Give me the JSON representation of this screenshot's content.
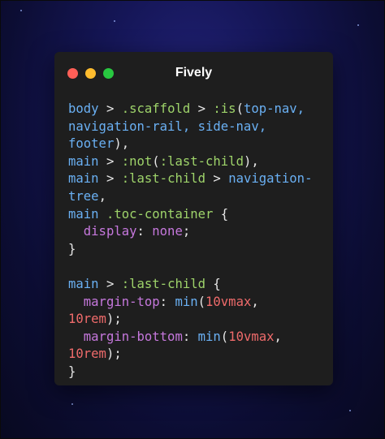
{
  "window": {
    "title": "Fively"
  },
  "colors": {
    "window_bg": "#1e1e1e",
    "close": "#ff5f57",
    "minimize": "#febc2e",
    "maximize": "#28c840",
    "tag": "#6ab0f3",
    "selector": "#9ed36a",
    "property": "#c678dd",
    "number": "#ef6b6b"
  },
  "code": {
    "lines": [
      [
        {
          "t": "body",
          "c": "tag"
        },
        {
          "t": " > ",
          "c": "punc"
        },
        {
          "t": ".scaffold",
          "c": "sel"
        },
        {
          "t": " > ",
          "c": "punc"
        },
        {
          "t": ":is",
          "c": "sel"
        },
        {
          "t": "(",
          "c": "punc"
        },
        {
          "t": "top-nav,",
          "c": "tag"
        }
      ],
      [
        {
          "t": "navigation-rail, side-nav,",
          "c": "tag"
        }
      ],
      [
        {
          "t": "footer",
          "c": "tag"
        },
        {
          "t": "),",
          "c": "punc"
        }
      ],
      [
        {
          "t": "main",
          "c": "tag"
        },
        {
          "t": " > ",
          "c": "punc"
        },
        {
          "t": ":not",
          "c": "sel"
        },
        {
          "t": "(",
          "c": "punc"
        },
        {
          "t": ":last-child",
          "c": "sel"
        },
        {
          "t": "),",
          "c": "punc"
        }
      ],
      [
        {
          "t": "main",
          "c": "tag"
        },
        {
          "t": " > ",
          "c": "punc"
        },
        {
          "t": ":last-child",
          "c": "sel"
        },
        {
          "t": " > ",
          "c": "punc"
        },
        {
          "t": "navigation-",
          "c": "tag"
        }
      ],
      [
        {
          "t": "tree",
          "c": "tag"
        },
        {
          "t": ",",
          "c": "punc"
        }
      ],
      [
        {
          "t": "main",
          "c": "tag"
        },
        {
          "t": " ",
          "c": "punc"
        },
        {
          "t": ".toc-container",
          "c": "sel"
        },
        {
          "t": " {",
          "c": "punc"
        }
      ],
      [
        {
          "t": "  ",
          "c": "punc"
        },
        {
          "t": "display",
          "c": "prop"
        },
        {
          "t": ": ",
          "c": "punc"
        },
        {
          "t": "none",
          "c": "prop"
        },
        {
          "t": ";",
          "c": "punc"
        }
      ],
      [
        {
          "t": "}",
          "c": "punc"
        }
      ],
      [
        {
          "t": "",
          "c": "punc"
        }
      ],
      [
        {
          "t": "main",
          "c": "tag"
        },
        {
          "t": " > ",
          "c": "punc"
        },
        {
          "t": ":last-child",
          "c": "sel"
        },
        {
          "t": " {",
          "c": "punc"
        }
      ],
      [
        {
          "t": "  ",
          "c": "punc"
        },
        {
          "t": "margin-top",
          "c": "prop"
        },
        {
          "t": ": ",
          "c": "punc"
        },
        {
          "t": "min",
          "c": "fn"
        },
        {
          "t": "(",
          "c": "punc"
        },
        {
          "t": "10vmax",
          "c": "num"
        },
        {
          "t": ",",
          "c": "punc"
        }
      ],
      [
        {
          "t": "10rem",
          "c": "num"
        },
        {
          "t": ");",
          "c": "punc"
        }
      ],
      [
        {
          "t": "  ",
          "c": "punc"
        },
        {
          "t": "margin-bottom",
          "c": "prop"
        },
        {
          "t": ": ",
          "c": "punc"
        },
        {
          "t": "min",
          "c": "fn"
        },
        {
          "t": "(",
          "c": "punc"
        },
        {
          "t": "10vmax",
          "c": "num"
        },
        {
          "t": ",",
          "c": "punc"
        }
      ],
      [
        {
          "t": "10rem",
          "c": "num"
        },
        {
          "t": ");",
          "c": "punc"
        }
      ],
      [
        {
          "t": "}",
          "c": "punc"
        }
      ]
    ]
  }
}
